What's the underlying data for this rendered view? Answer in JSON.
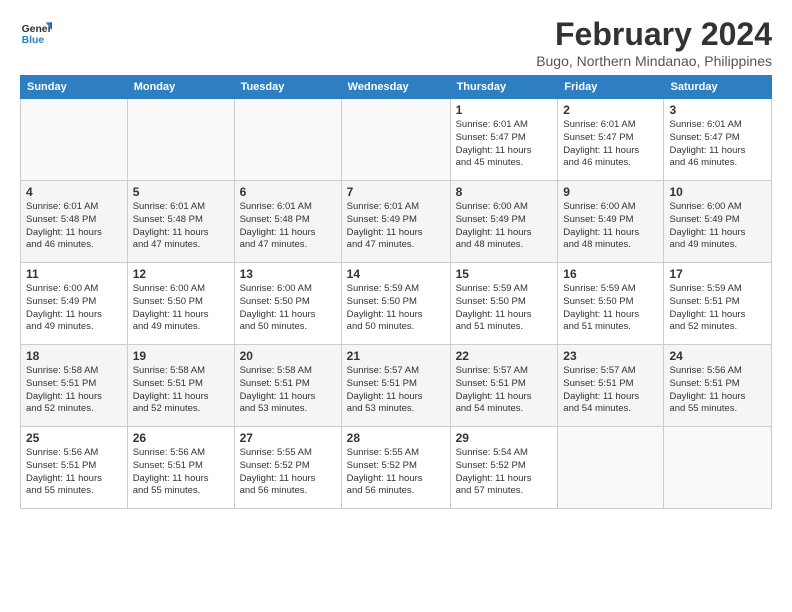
{
  "logo": {
    "line1": "General",
    "line2": "Blue"
  },
  "title": "February 2024",
  "subtitle": "Bugo, Northern Mindanao, Philippines",
  "weekdays": [
    "Sunday",
    "Monday",
    "Tuesday",
    "Wednesday",
    "Thursday",
    "Friday",
    "Saturday"
  ],
  "weeks": [
    [
      {
        "day": "",
        "info": ""
      },
      {
        "day": "",
        "info": ""
      },
      {
        "day": "",
        "info": ""
      },
      {
        "day": "",
        "info": ""
      },
      {
        "day": "1",
        "info": "Sunrise: 6:01 AM\nSunset: 5:47 PM\nDaylight: 11 hours\nand 45 minutes."
      },
      {
        "day": "2",
        "info": "Sunrise: 6:01 AM\nSunset: 5:47 PM\nDaylight: 11 hours\nand 46 minutes."
      },
      {
        "day": "3",
        "info": "Sunrise: 6:01 AM\nSunset: 5:47 PM\nDaylight: 11 hours\nand 46 minutes."
      }
    ],
    [
      {
        "day": "4",
        "info": "Sunrise: 6:01 AM\nSunset: 5:48 PM\nDaylight: 11 hours\nand 46 minutes."
      },
      {
        "day": "5",
        "info": "Sunrise: 6:01 AM\nSunset: 5:48 PM\nDaylight: 11 hours\nand 47 minutes."
      },
      {
        "day": "6",
        "info": "Sunrise: 6:01 AM\nSunset: 5:48 PM\nDaylight: 11 hours\nand 47 minutes."
      },
      {
        "day": "7",
        "info": "Sunrise: 6:01 AM\nSunset: 5:49 PM\nDaylight: 11 hours\nand 47 minutes."
      },
      {
        "day": "8",
        "info": "Sunrise: 6:00 AM\nSunset: 5:49 PM\nDaylight: 11 hours\nand 48 minutes."
      },
      {
        "day": "9",
        "info": "Sunrise: 6:00 AM\nSunset: 5:49 PM\nDaylight: 11 hours\nand 48 minutes."
      },
      {
        "day": "10",
        "info": "Sunrise: 6:00 AM\nSunset: 5:49 PM\nDaylight: 11 hours\nand 49 minutes."
      }
    ],
    [
      {
        "day": "11",
        "info": "Sunrise: 6:00 AM\nSunset: 5:49 PM\nDaylight: 11 hours\nand 49 minutes."
      },
      {
        "day": "12",
        "info": "Sunrise: 6:00 AM\nSunset: 5:50 PM\nDaylight: 11 hours\nand 49 minutes."
      },
      {
        "day": "13",
        "info": "Sunrise: 6:00 AM\nSunset: 5:50 PM\nDaylight: 11 hours\nand 50 minutes."
      },
      {
        "day": "14",
        "info": "Sunrise: 5:59 AM\nSunset: 5:50 PM\nDaylight: 11 hours\nand 50 minutes."
      },
      {
        "day": "15",
        "info": "Sunrise: 5:59 AM\nSunset: 5:50 PM\nDaylight: 11 hours\nand 51 minutes."
      },
      {
        "day": "16",
        "info": "Sunrise: 5:59 AM\nSunset: 5:50 PM\nDaylight: 11 hours\nand 51 minutes."
      },
      {
        "day": "17",
        "info": "Sunrise: 5:59 AM\nSunset: 5:51 PM\nDaylight: 11 hours\nand 52 minutes."
      }
    ],
    [
      {
        "day": "18",
        "info": "Sunrise: 5:58 AM\nSunset: 5:51 PM\nDaylight: 11 hours\nand 52 minutes."
      },
      {
        "day": "19",
        "info": "Sunrise: 5:58 AM\nSunset: 5:51 PM\nDaylight: 11 hours\nand 52 minutes."
      },
      {
        "day": "20",
        "info": "Sunrise: 5:58 AM\nSunset: 5:51 PM\nDaylight: 11 hours\nand 53 minutes."
      },
      {
        "day": "21",
        "info": "Sunrise: 5:57 AM\nSunset: 5:51 PM\nDaylight: 11 hours\nand 53 minutes."
      },
      {
        "day": "22",
        "info": "Sunrise: 5:57 AM\nSunset: 5:51 PM\nDaylight: 11 hours\nand 54 minutes."
      },
      {
        "day": "23",
        "info": "Sunrise: 5:57 AM\nSunset: 5:51 PM\nDaylight: 11 hours\nand 54 minutes."
      },
      {
        "day": "24",
        "info": "Sunrise: 5:56 AM\nSunset: 5:51 PM\nDaylight: 11 hours\nand 55 minutes."
      }
    ],
    [
      {
        "day": "25",
        "info": "Sunrise: 5:56 AM\nSunset: 5:51 PM\nDaylight: 11 hours\nand 55 minutes."
      },
      {
        "day": "26",
        "info": "Sunrise: 5:56 AM\nSunset: 5:51 PM\nDaylight: 11 hours\nand 55 minutes."
      },
      {
        "day": "27",
        "info": "Sunrise: 5:55 AM\nSunset: 5:52 PM\nDaylight: 11 hours\nand 56 minutes."
      },
      {
        "day": "28",
        "info": "Sunrise: 5:55 AM\nSunset: 5:52 PM\nDaylight: 11 hours\nand 56 minutes."
      },
      {
        "day": "29",
        "info": "Sunrise: 5:54 AM\nSunset: 5:52 PM\nDaylight: 11 hours\nand 57 minutes."
      },
      {
        "day": "",
        "info": ""
      },
      {
        "day": "",
        "info": ""
      }
    ]
  ]
}
